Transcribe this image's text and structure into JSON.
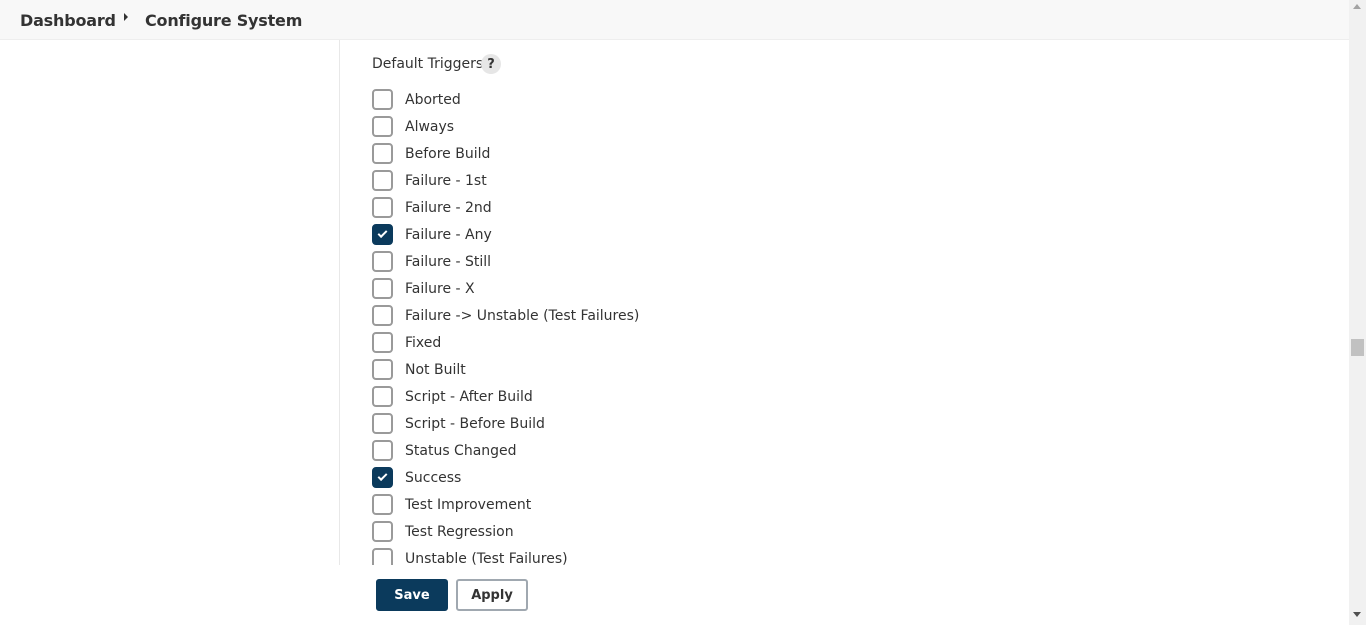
{
  "breadcrumb": {
    "items": [
      "Dashboard",
      "Configure System"
    ]
  },
  "section": {
    "title": "Default Triggers",
    "help": "?"
  },
  "triggers": [
    {
      "label": "Aborted",
      "checked": false
    },
    {
      "label": "Always",
      "checked": false
    },
    {
      "label": "Before Build",
      "checked": false
    },
    {
      "label": "Failure - 1st",
      "checked": false
    },
    {
      "label": "Failure - 2nd",
      "checked": false
    },
    {
      "label": "Failure - Any",
      "checked": true
    },
    {
      "label": "Failure - Still",
      "checked": false
    },
    {
      "label": "Failure - X",
      "checked": false
    },
    {
      "label": "Failure -> Unstable (Test Failures)",
      "checked": false
    },
    {
      "label": "Fixed",
      "checked": false
    },
    {
      "label": "Not Built",
      "checked": false
    },
    {
      "label": "Script - After Build",
      "checked": false
    },
    {
      "label": "Script - Before Build",
      "checked": false
    },
    {
      "label": "Status Changed",
      "checked": false
    },
    {
      "label": "Success",
      "checked": true
    },
    {
      "label": "Test Improvement",
      "checked": false
    },
    {
      "label": "Test Regression",
      "checked": false
    },
    {
      "label": "Unstable (Test Failures)",
      "checked": false
    }
  ],
  "actions": {
    "save_label": "Save",
    "apply_label": "Apply"
  },
  "colors": {
    "primary": "#0b3a5c",
    "header_bg": "#f8f8f8"
  }
}
